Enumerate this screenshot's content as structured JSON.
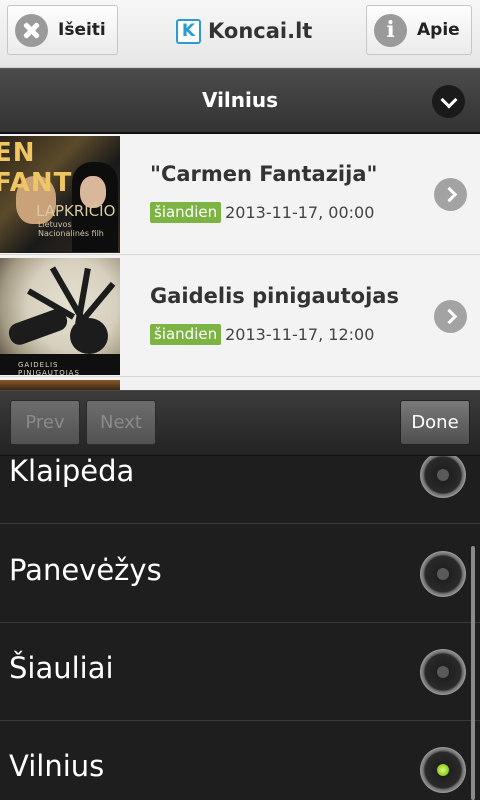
{
  "header": {
    "exit_label": "Išeiti",
    "about_label": "Apie",
    "brand_letter": "K",
    "brand_name": "Koncai.lt"
  },
  "city_selector": {
    "value": "Vilnius"
  },
  "events": [
    {
      "title": "\"Carmen Fantazija\"",
      "badge": "šiandien",
      "datetime": "2013-11-17, 00:00",
      "thumb_text": [
        "EN FANT",
        "LAPKRIČIO",
        "Lietuvos Nacionalinės filh"
      ]
    },
    {
      "title": "Gaidelis pinigautojas",
      "badge": "šiandien",
      "datetime": "2013-11-17, 12:00",
      "thumb_text": [
        "GAIDELIS PINIGAUTOJAS"
      ]
    }
  ],
  "picker": {
    "prev_label": "Prev",
    "next_label": "Next",
    "done_label": "Done",
    "options": [
      "Klaipėda",
      "Panevėžys",
      "Šiauliai",
      "Vilnius"
    ],
    "selected": "Vilnius"
  },
  "colors": {
    "badge": "#7cb342",
    "brand_blue": "#2b9bd3",
    "radio_selected": "#9ad12a"
  }
}
